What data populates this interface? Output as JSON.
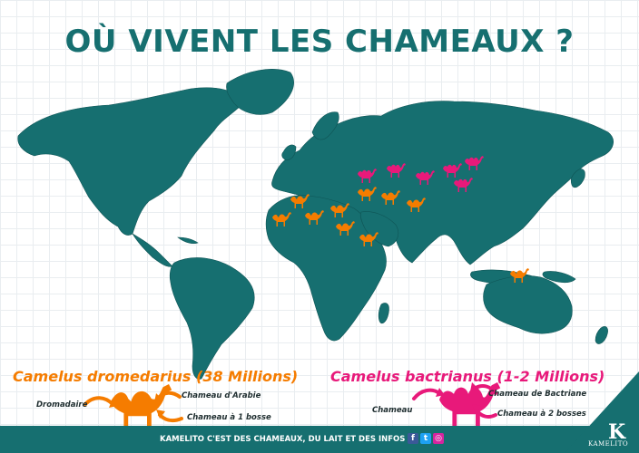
{
  "title": "OÙ VIVENT LES CHAMEAUX ?",
  "colors": {
    "teal": "#166f70",
    "orange": "#f57c00",
    "pink": "#e8197a"
  },
  "dromedarius": {
    "heading": "Camelus dromedarius (38 Millions)",
    "label_left": "Dromadaire",
    "label_top": "Chameau d'Arabie",
    "label_bottom": "Chameau à 1 bosse"
  },
  "bactrianus": {
    "heading": "Camelus bactrianus (1-2 Millions)",
    "label_left": "Chameau",
    "label_top": "Chameau de Bactriane",
    "label_bottom": "Chameau à 2 bosses"
  },
  "footer": {
    "text": "KAMELITO C'EST DES CHAMEAUX, DU LAIT ET DES INFOS !",
    "social_icons": [
      "facebook-icon",
      "twitter-icon",
      "instagram-icon"
    ]
  },
  "brand": {
    "name": "KAMELITO",
    "logo_letter": "K"
  }
}
